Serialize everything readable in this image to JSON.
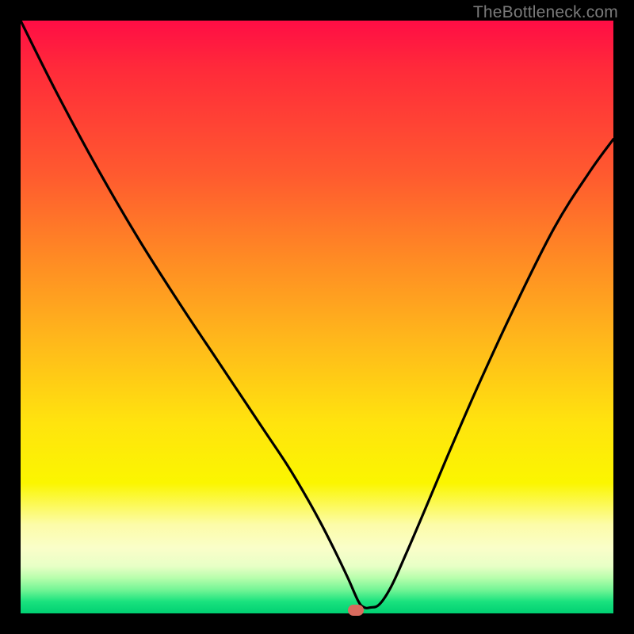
{
  "watermark": "TheBottleneck.com",
  "chart_data": {
    "type": "line",
    "title": "",
    "xlabel": "",
    "ylabel": "",
    "xlim": [
      0,
      1
    ],
    "ylim": [
      0,
      1
    ],
    "series": [
      {
        "name": "bottleneck-curve",
        "x": [
          0.0,
          0.06,
          0.13,
          0.2,
          0.27,
          0.33,
          0.37,
          0.41,
          0.45,
          0.48,
          0.505,
          0.528,
          0.552,
          0.57,
          0.58,
          0.59,
          0.605,
          0.625,
          0.65,
          0.68,
          0.72,
          0.77,
          0.83,
          0.9,
          0.96,
          1.0
        ],
        "y": [
          1.0,
          0.88,
          0.75,
          0.63,
          0.52,
          0.43,
          0.37,
          0.31,
          0.25,
          0.2,
          0.155,
          0.11,
          0.06,
          0.02,
          0.01,
          0.01,
          0.015,
          0.045,
          0.1,
          0.17,
          0.265,
          0.38,
          0.51,
          0.65,
          0.745,
          0.8
        ]
      }
    ],
    "annotations": [
      {
        "name": "min-marker",
        "x": 0.565,
        "y": 0.005
      }
    ],
    "background_gradient": {
      "top": "#ff0d45",
      "upper_mid": "#ff8a24",
      "mid": "#ffe40e",
      "pale_band": "#fafec9",
      "bottom": "#00d072"
    }
  }
}
